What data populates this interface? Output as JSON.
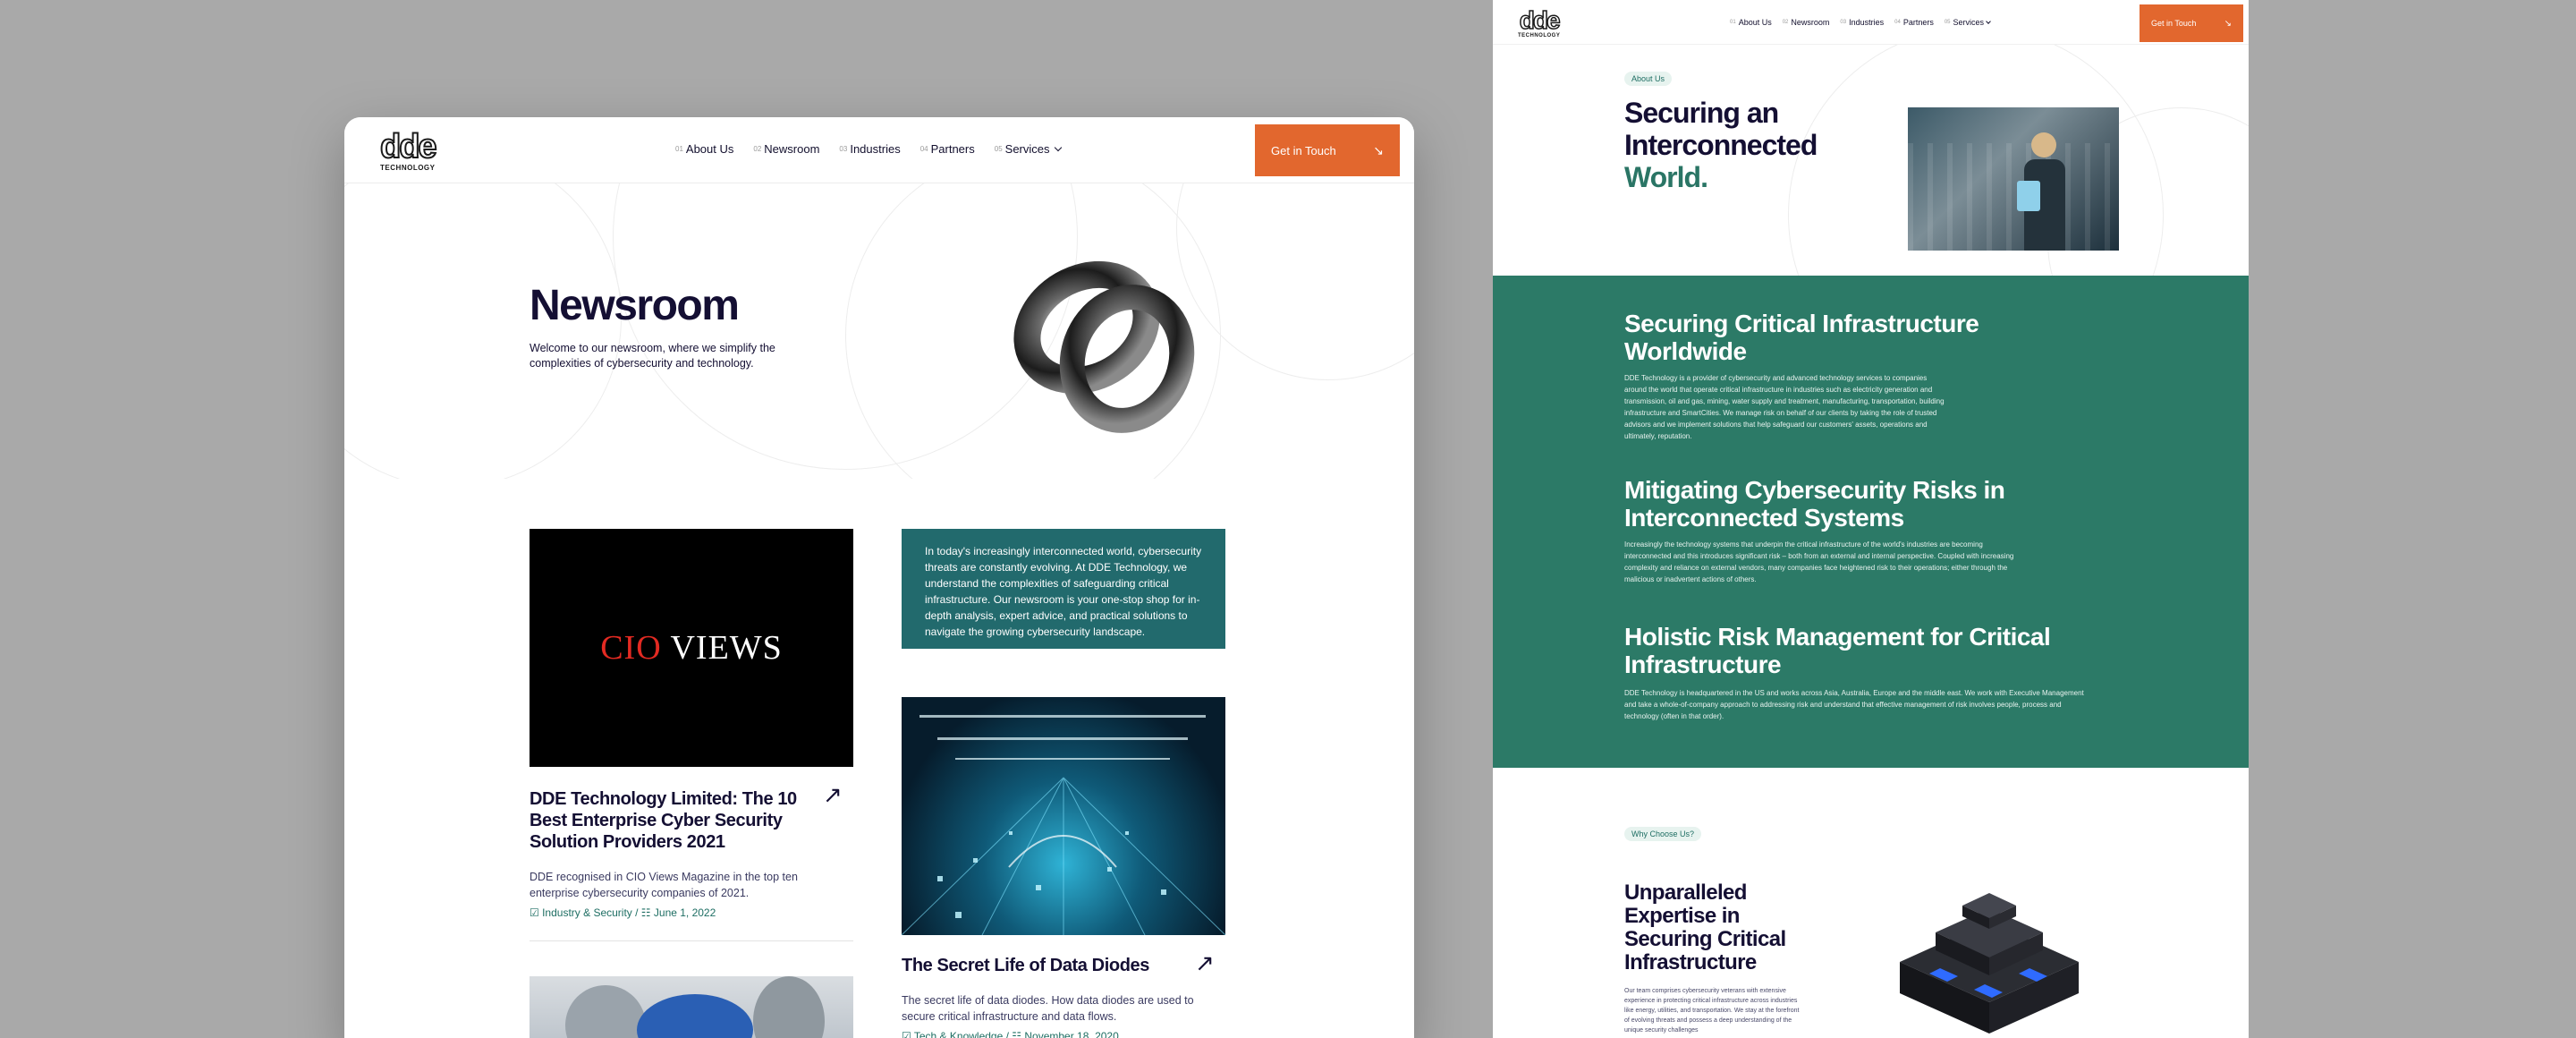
{
  "left": {
    "nav": {
      "logo_mark": "dde",
      "logo_sub": "TECHNOLOGY",
      "items": [
        {
          "pre": "01",
          "label": "About Us"
        },
        {
          "pre": "02",
          "label": "Newsroom"
        },
        {
          "pre": "03",
          "label": "Industries"
        },
        {
          "pre": "04",
          "label": "Partners"
        },
        {
          "pre": "05",
          "label": "Services"
        }
      ],
      "cta": "Get in Touch"
    },
    "hero": {
      "title": "Newsroom",
      "subtitle": "Welcome to our newsroom, where we simplify the complexities of cybersecurity and technology."
    },
    "cards": {
      "cio_red": "CIO",
      "cio_white": "VIEWS",
      "card1_title": "DDE Technology Limited: The 10 Best Enterprise Cyber Security Solution Providers 2021",
      "card1_desc": "DDE recognised in CIO Views Magazine in the top ten enterprise cybersecurity companies of 2021.",
      "card1_meta": "☑ Industry & Security / ☷ June 1, 2022",
      "intro": "In today's increasingly interconnected world, cybersecurity threats are constantly evolving. At DDE Technology, we understand the complexities of safeguarding critical infrastructure. Our newsroom is your one-stop shop for in-depth analysis, expert advice, and practical solutions to navigate the growing cybersecurity landscape.",
      "card2_title": "The Secret Life of Data Diodes",
      "card2_desc": "The secret life of data diodes. How data diodes are used to secure critical infrastructure and data flows.",
      "card2_meta": "☑ Tech & Knowledge / ☷ November 18, 2020"
    }
  },
  "right": {
    "nav": {
      "logo_mark": "dde",
      "logo_sub": "TECHNOLOGY",
      "items": [
        {
          "pre": "01",
          "label": "About Us"
        },
        {
          "pre": "02",
          "label": "Newsroom"
        },
        {
          "pre": "03",
          "label": "Industries"
        },
        {
          "pre": "04",
          "label": "Partners"
        },
        {
          "pre": "05",
          "label": "Services"
        }
      ],
      "cta": "Get in Touch"
    },
    "about_pill": "About Us",
    "title_l1": "Securing an",
    "title_l2": "Interconnected",
    "title_accent": "World.",
    "sections": [
      {
        "heading": "Securing Critical Infrastructure Worldwide",
        "body": "DDE Technology is a provider of cybersecurity and advanced technology services to companies around the world that operate critical infrastructure in industries such as electricity generation and transmission, oil and gas, mining, water supply and treatment, manufacturing, transportation, building infrastructure and SmartCities. We manage risk on behalf of our clients by taking the role of trusted advisors and we implement solutions that help safeguard our customers' assets, operations and ultimately, reputation."
      },
      {
        "heading": "Mitigating Cybersecurity Risks in Interconnected Systems",
        "body": "Increasingly the technology systems that underpin the critical infrastructure of the world's industries are becoming interconnected and this introduces significant risk – both from an external and internal perspective. Coupled with increasing complexity and reliance on external vendors, many companies face heightened risk to their operations; either through the malicious or inadvertent actions of others."
      },
      {
        "heading": "Holistic Risk Management for Critical Infrastructure",
        "body": "DDE Technology is headquartered in the US and works across Asia, Australia, Europe and the middle east. We work with Executive Management and take a whole-of-company approach to addressing risk and understand that effective management of risk involves people, process and technology (often in that order)."
      }
    ],
    "why_pill": "Why Choose Us?",
    "why_title": "Unparalleled Expertise in Securing Critical Infrastructure",
    "why_desc": "Our team comprises cybersecurity veterans with extensive experience in protecting critical infrastructure across industries like energy, utilities, and transportation. We stay at the forefront of evolving threats and possess a deep understanding of the unique security challenges"
  },
  "colors": {
    "accent_orange": "#e2672e",
    "teal_box": "#226a6d",
    "green_band": "#2c7a67",
    "ink": "#140f33"
  }
}
